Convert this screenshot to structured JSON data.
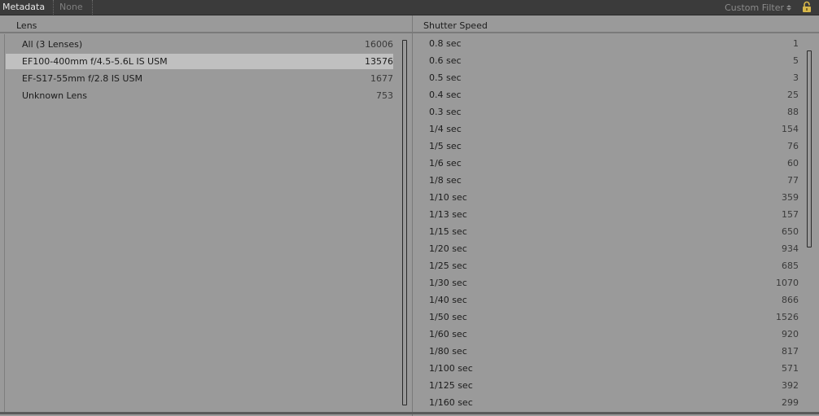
{
  "filter_bar": {
    "tab_metadata": "Metadata",
    "tab_none": "None",
    "custom_filter": "Custom Filter",
    "lock_icon": "lock-icon"
  },
  "lens": {
    "header": "Lens",
    "rows": [
      {
        "label": "All (3 Lenses)",
        "count": "16006"
      },
      {
        "label": "EF100-400mm f/4.5-5.6L IS USM",
        "count": "13576",
        "selected": true
      },
      {
        "label": "EF-S17-55mm f/2.8 IS USM",
        "count": "1677"
      },
      {
        "label": "Unknown Lens",
        "count": "753"
      }
    ]
  },
  "shutter": {
    "header": "Shutter Speed",
    "rows": [
      {
        "label": "0.8 sec",
        "count": "1"
      },
      {
        "label": "0.6 sec",
        "count": "5"
      },
      {
        "label": "0.5 sec",
        "count": "3"
      },
      {
        "label": "0.4 sec",
        "count": "25"
      },
      {
        "label": "0.3 sec",
        "count": "88"
      },
      {
        "label": "1/4 sec",
        "count": "154"
      },
      {
        "label": "1/5 sec",
        "count": "76"
      },
      {
        "label": "1/6 sec",
        "count": "60"
      },
      {
        "label": "1/8 sec",
        "count": "77"
      },
      {
        "label": "1/10 sec",
        "count": "359"
      },
      {
        "label": "1/13 sec",
        "count": "157"
      },
      {
        "label": "1/15 sec",
        "count": "650"
      },
      {
        "label": "1/20 sec",
        "count": "934"
      },
      {
        "label": "1/25 sec",
        "count": "685"
      },
      {
        "label": "1/30 sec",
        "count": "1070"
      },
      {
        "label": "1/40 sec",
        "count": "866"
      },
      {
        "label": "1/50 sec",
        "count": "1526"
      },
      {
        "label": "1/60 sec",
        "count": "920"
      },
      {
        "label": "1/80 sec",
        "count": "817"
      },
      {
        "label": "1/100 sec",
        "count": "571"
      },
      {
        "label": "1/125 sec",
        "count": "392"
      },
      {
        "label": "1/160 sec",
        "count": "299"
      }
    ]
  }
}
